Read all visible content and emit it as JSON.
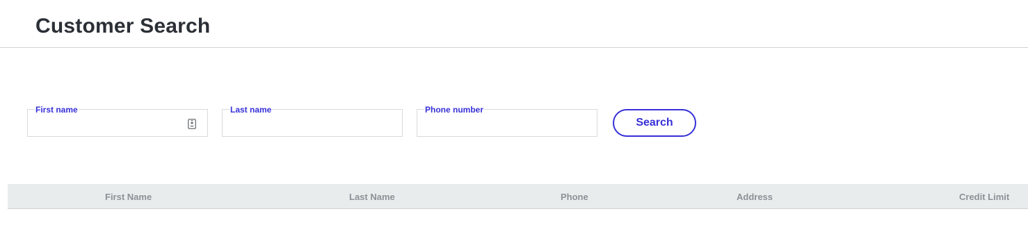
{
  "page": {
    "title": "Customer Search"
  },
  "search_form": {
    "first_name": {
      "label": "First name",
      "value": "",
      "placeholder": ""
    },
    "last_name": {
      "label": "Last name",
      "value": "",
      "placeholder": ""
    },
    "phone": {
      "label": "Phone number",
      "value": "",
      "placeholder": ""
    },
    "contact_icon": "contact-card-icon",
    "search_button_label": "Search"
  },
  "table": {
    "columns": [
      "First Name",
      "Last Name",
      "Phone",
      "Address",
      "Credit Limit"
    ],
    "rows": []
  },
  "colors": {
    "accent": "#3630d8",
    "title_text": "#2b2f36",
    "header_bg": "#e9eced",
    "header_text": "#8d9196"
  }
}
